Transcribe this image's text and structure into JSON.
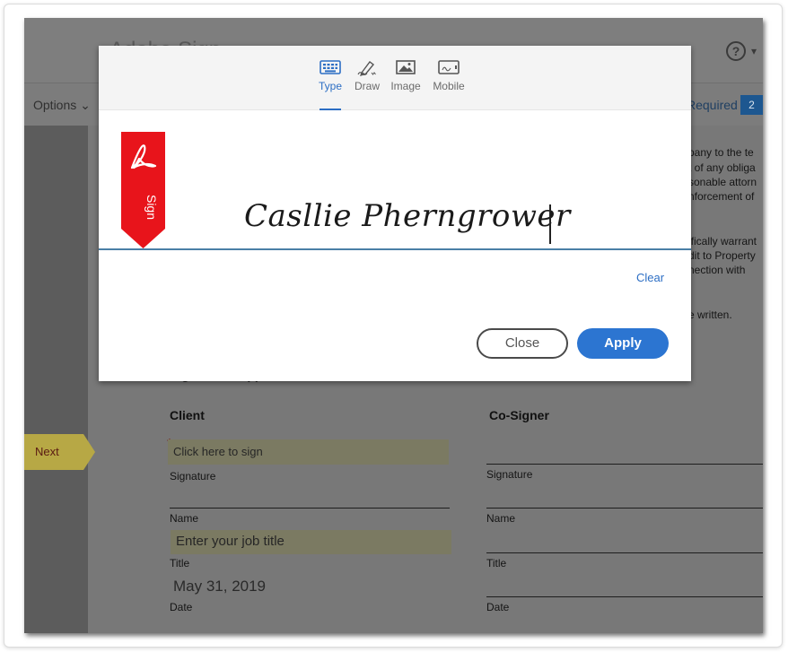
{
  "app": {
    "title": "Adobe Sign",
    "help_icon": "question-circle-icon",
    "help_glyph": "?",
    "help_caret": "▾",
    "options_label": "Options ⌄",
    "required_label": "Required",
    "required_count": "2"
  },
  "document": {
    "paragraph_fragments": [
      "pany to the te",
      "t of any obliga",
      "sonable attorn",
      "nforcement of",
      "ifically warrant",
      "dit to Property",
      "nection  with",
      "e written."
    ],
    "section_heading": "Signatures/Approval",
    "client": {
      "heading": "Client",
      "signature_placeholder": "Click here to sign",
      "signature_label": "Signature",
      "name_label": "Name",
      "title_placeholder": "Enter your job title",
      "title_label": "Title",
      "date_value": "May 31, 2019",
      "date_label": "Date"
    },
    "cosigner": {
      "heading": "Co-Signer",
      "signature_label": "Signature",
      "name_label": "Name",
      "title_label": "Title",
      "date_label": "Date"
    },
    "required_mark": "*",
    "next_label": "Next"
  },
  "modal": {
    "tabs": [
      {
        "label": "Type",
        "icon": "keyboard-icon",
        "active": true
      },
      {
        "label": "Draw",
        "icon": "pen-icon",
        "active": false
      },
      {
        "label": "Image",
        "icon": "image-icon",
        "active": false
      },
      {
        "label": "Mobile",
        "icon": "mobile-icon",
        "active": false
      }
    ],
    "bookmark_icon": "acrobat-logo-icon",
    "bookmark_label": "Sign",
    "signature_text": "Casllie Pherngrower",
    "clear_label": "Clear",
    "close_label": "Close",
    "apply_label": "Apply"
  },
  "colors": {
    "accent": "#2c75d1",
    "tab_active": "#2c6ec4",
    "bookmark_red": "#e8141b",
    "required_badge": "#1d5790",
    "next_tag": "#b7a845",
    "field_fill": "#7b7a62"
  }
}
